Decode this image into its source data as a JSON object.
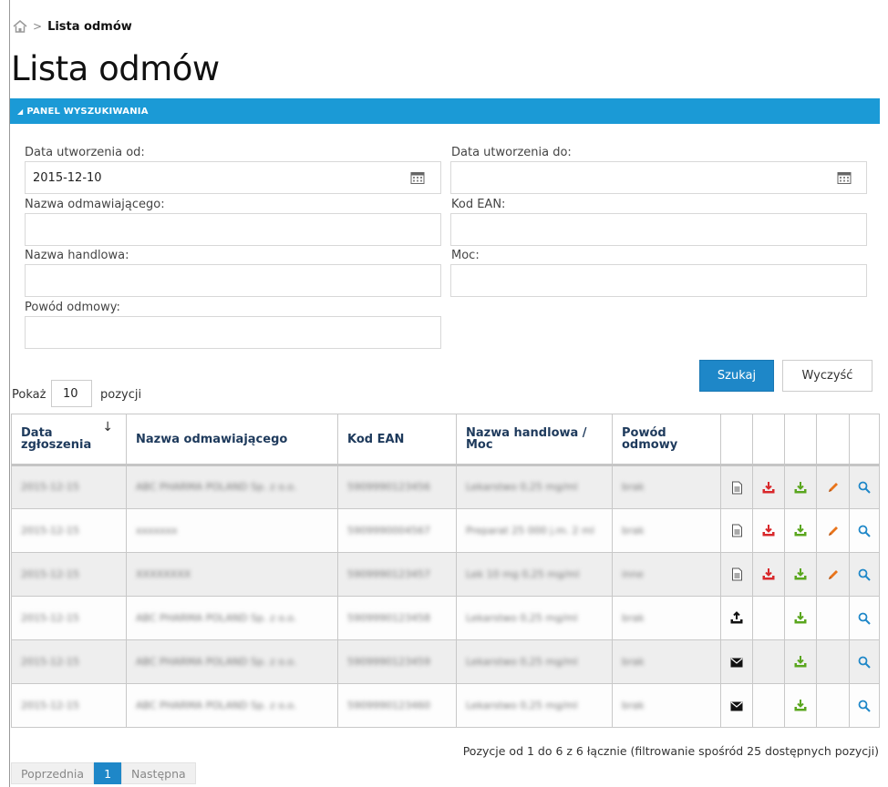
{
  "breadcrumb": {
    "current": "Lista odmów"
  },
  "page_title": "Lista odmów",
  "panel": {
    "title": "PANEL WYSZUKIWANIA"
  },
  "form": {
    "date_from": {
      "label": "Data utworzenia od:",
      "value": "2015-12-10"
    },
    "date_to": {
      "label": "Data utworzenia do:",
      "value": ""
    },
    "refuser_name": {
      "label": "Nazwa odmawiającego:",
      "value": ""
    },
    "ean": {
      "label": "Kod EAN:",
      "value": ""
    },
    "trade_name": {
      "label": "Nazwa handlowa:",
      "value": ""
    },
    "strength": {
      "label": "Moc:",
      "value": ""
    },
    "reason": {
      "label": "Powód odmowy:",
      "value": ""
    },
    "search_label": "Szukaj",
    "clear_label": "Wyczyść"
  },
  "page_size": {
    "prefix": "Pokaż",
    "value": "10",
    "suffix": "pozycji"
  },
  "table": {
    "columns": [
      "Data zgłoszenia",
      "Nazwa odmawiającego",
      "Kod EAN",
      "Nazwa handlowa / Moc",
      "Powód odmowy"
    ],
    "sort_indicator": "↓",
    "rows": [
      {
        "date": "2015-12-15",
        "name": "ABC PHARMA POLAND Sp. z o.o.",
        "ean": "5909990123456",
        "trade": "Lekarstwo 0,25 mg/ml",
        "reason": "brak",
        "icons": [
          "document-icon",
          "download-red-icon",
          "download-green-icon",
          "edit-pencil-icon",
          "search-icon"
        ]
      },
      {
        "date": "2015-12-15",
        "name": "xxxxxxx",
        "ean": "5909990004567",
        "trade": "Preparat 25 000 j.m. 2 ml",
        "reason": "brak",
        "icons": [
          "document-icon",
          "download-red-icon",
          "download-green-icon",
          "edit-pencil-icon",
          "search-icon"
        ]
      },
      {
        "date": "2015-12-15",
        "name": "XXXXXXXX",
        "ean": "5909990123457",
        "trade": "Lek 10 mg 0,25 mg/ml",
        "reason": "inne",
        "icons": [
          "document-icon",
          "download-red-icon",
          "download-green-icon",
          "edit-pencil-icon",
          "search-icon"
        ]
      },
      {
        "date": "2015-12-15",
        "name": "ABC PHARMA POLAND Sp. z o.o.",
        "ean": "5909990123458",
        "trade": "Lekarstwo 0,25 mg/ml",
        "reason": "brak",
        "icons": [
          "upload-black-icon",
          "",
          "download-green-icon",
          "",
          "search-icon"
        ]
      },
      {
        "date": "2015-12-15",
        "name": "ABC PHARMA POLAND Sp. z o.o.",
        "ean": "5909990123459",
        "trade": "Lekarstwo 0,25 mg/ml",
        "reason": "brak",
        "icons": [
          "envelope-icon",
          "",
          "download-green-icon",
          "",
          "search-icon"
        ]
      },
      {
        "date": "2015-12-15",
        "name": "ABC PHARMA POLAND Sp. z o.o.",
        "ean": "5909990123460",
        "trade": "Lekarstwo 0,25 mg/ml",
        "reason": "brak",
        "icons": [
          "envelope-icon",
          "",
          "download-green-icon",
          "",
          "search-icon"
        ]
      }
    ]
  },
  "info_text": "Pozycje od 1 do 6 z 6 łącznie (filtrowanie spośród 25 dostępnych pozycji)",
  "pager": {
    "prev": "Poprzednia",
    "current": "1",
    "next": "Następna"
  },
  "colors": {
    "accent": "#1b9ad6",
    "primary_button": "#1e87c8",
    "red_icon": "#d8282b",
    "green_icon": "#5aa61e",
    "pencil": "#e8741b"
  }
}
